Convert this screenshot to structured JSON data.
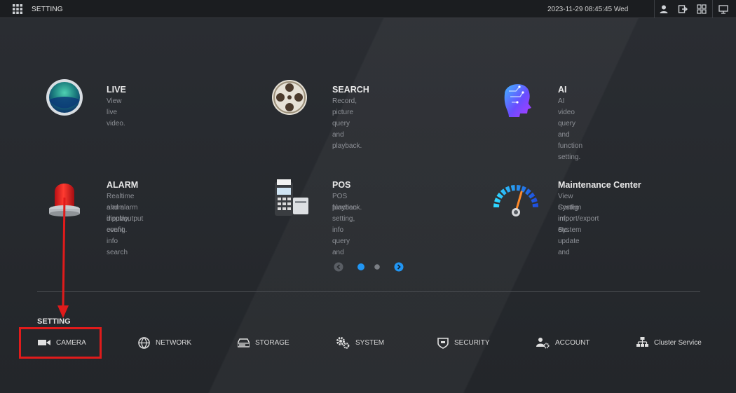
{
  "header": {
    "title": "SETTING",
    "datetime": "2023-11-29 08:45:45 Wed",
    "icons": [
      "apps-grid-icon",
      "user-icon",
      "logout-icon",
      "layout-icon",
      "monitor-icon"
    ]
  },
  "tiles": [
    {
      "title": "LIVE",
      "desc1": "View live video.",
      "desc2": "",
      "icon": "live-globe-icon"
    },
    {
      "title": "SEARCH",
      "desc1": "Record, picture query and playback.",
      "desc2": "",
      "icon": "film-reel-icon"
    },
    {
      "title": "AI",
      "desc1": "AI video query and function setting.",
      "desc2": "",
      "icon": "ai-head-icon"
    },
    {
      "title": "ALARM",
      "desc1": "Realtime alarm display, event info search",
      "desc2": "and alarm input/output config.",
      "icon": "alarm-siren-icon"
    },
    {
      "title": "POS",
      "desc1": "POS function setting, info query and",
      "desc2": "playback.",
      "icon": "pos-terminal-icon"
    },
    {
      "title": "Maintenance Center",
      "desc1": "View System info, System update and",
      "desc2": "Config import/export etc.",
      "icon": "gauge-icon"
    }
  ],
  "pager": {
    "pages": 2,
    "current": 1
  },
  "setting": {
    "label": "SETTING",
    "items": [
      {
        "label": "CAMERA",
        "icon": "camera-icon"
      },
      {
        "label": "NETWORK",
        "icon": "network-globe-icon"
      },
      {
        "label": "STORAGE",
        "icon": "storage-icon"
      },
      {
        "label": "SYSTEM",
        "icon": "gears-icon"
      },
      {
        "label": "SECURITY",
        "icon": "shield-icon"
      },
      {
        "label": "ACCOUNT",
        "icon": "account-icon"
      },
      {
        "label": "Cluster Service",
        "icon": "cluster-icon"
      }
    ]
  },
  "colors": {
    "accent": "#2196f3",
    "highlight": "#e01b1b",
    "background": "#25282d"
  }
}
